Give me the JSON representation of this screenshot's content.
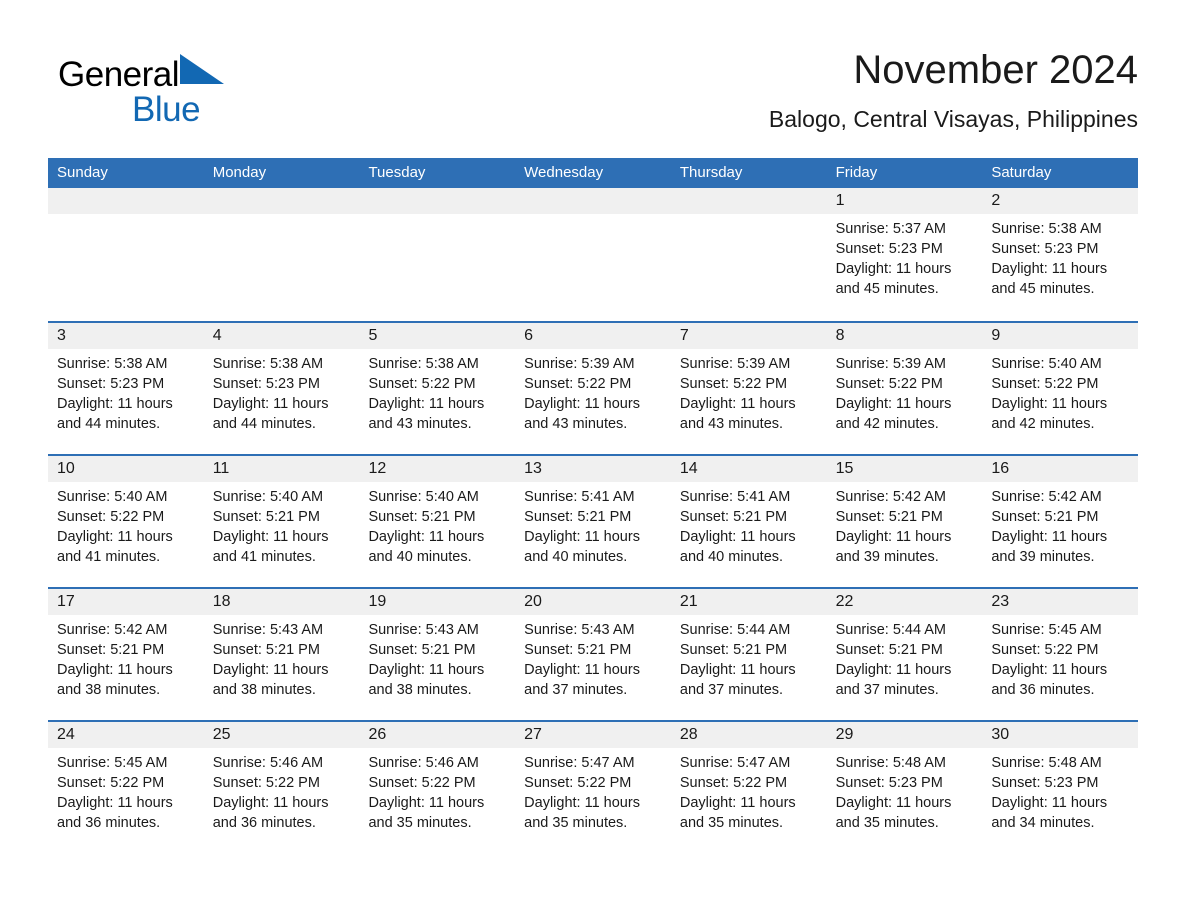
{
  "brand": {
    "name_part1": "General",
    "name_part2": "Blue",
    "triangle_color": "#1268b3"
  },
  "header": {
    "title": "November 2024",
    "subtitle": "Balogo, Central Visayas, Philippines"
  },
  "theme": {
    "accent_blue": "#2e6fb5",
    "header_text": "#ffffff",
    "day_band_gray": "#f0f0f0",
    "text": "#1a1a1a"
  },
  "weekdays": [
    "Sunday",
    "Monday",
    "Tuesday",
    "Wednesday",
    "Thursday",
    "Friday",
    "Saturday"
  ],
  "labels": {
    "sunrise_prefix": "Sunrise:",
    "sunset_prefix": "Sunset:",
    "daylight_prefix": "Daylight:"
  },
  "weeks": [
    [
      {
        "day": "",
        "empty": true
      },
      {
        "day": "",
        "empty": true
      },
      {
        "day": "",
        "empty": true
      },
      {
        "day": "",
        "empty": true
      },
      {
        "day": "",
        "empty": true
      },
      {
        "day": "1",
        "sunrise": "Sunrise: 5:37 AM",
        "sunset": "Sunset: 5:23 PM",
        "daylight": "Daylight: 11 hours and 45 minutes."
      },
      {
        "day": "2",
        "sunrise": "Sunrise: 5:38 AM",
        "sunset": "Sunset: 5:23 PM",
        "daylight": "Daylight: 11 hours and 45 minutes."
      }
    ],
    [
      {
        "day": "3",
        "sunrise": "Sunrise: 5:38 AM",
        "sunset": "Sunset: 5:23 PM",
        "daylight": "Daylight: 11 hours and 44 minutes."
      },
      {
        "day": "4",
        "sunrise": "Sunrise: 5:38 AM",
        "sunset": "Sunset: 5:23 PM",
        "daylight": "Daylight: 11 hours and 44 minutes."
      },
      {
        "day": "5",
        "sunrise": "Sunrise: 5:38 AM",
        "sunset": "Sunset: 5:22 PM",
        "daylight": "Daylight: 11 hours and 43 minutes."
      },
      {
        "day": "6",
        "sunrise": "Sunrise: 5:39 AM",
        "sunset": "Sunset: 5:22 PM",
        "daylight": "Daylight: 11 hours and 43 minutes."
      },
      {
        "day": "7",
        "sunrise": "Sunrise: 5:39 AM",
        "sunset": "Sunset: 5:22 PM",
        "daylight": "Daylight: 11 hours and 43 minutes."
      },
      {
        "day": "8",
        "sunrise": "Sunrise: 5:39 AM",
        "sunset": "Sunset: 5:22 PM",
        "daylight": "Daylight: 11 hours and 42 minutes."
      },
      {
        "day": "9",
        "sunrise": "Sunrise: 5:40 AM",
        "sunset": "Sunset: 5:22 PM",
        "daylight": "Daylight: 11 hours and 42 minutes."
      }
    ],
    [
      {
        "day": "10",
        "sunrise": "Sunrise: 5:40 AM",
        "sunset": "Sunset: 5:22 PM",
        "daylight": "Daylight: 11 hours and 41 minutes."
      },
      {
        "day": "11",
        "sunrise": "Sunrise: 5:40 AM",
        "sunset": "Sunset: 5:21 PM",
        "daylight": "Daylight: 11 hours and 41 minutes."
      },
      {
        "day": "12",
        "sunrise": "Sunrise: 5:40 AM",
        "sunset": "Sunset: 5:21 PM",
        "daylight": "Daylight: 11 hours and 40 minutes."
      },
      {
        "day": "13",
        "sunrise": "Sunrise: 5:41 AM",
        "sunset": "Sunset: 5:21 PM",
        "daylight": "Daylight: 11 hours and 40 minutes."
      },
      {
        "day": "14",
        "sunrise": "Sunrise: 5:41 AM",
        "sunset": "Sunset: 5:21 PM",
        "daylight": "Daylight: 11 hours and 40 minutes."
      },
      {
        "day": "15",
        "sunrise": "Sunrise: 5:42 AM",
        "sunset": "Sunset: 5:21 PM",
        "daylight": "Daylight: 11 hours and 39 minutes."
      },
      {
        "day": "16",
        "sunrise": "Sunrise: 5:42 AM",
        "sunset": "Sunset: 5:21 PM",
        "daylight": "Daylight: 11 hours and 39 minutes."
      }
    ],
    [
      {
        "day": "17",
        "sunrise": "Sunrise: 5:42 AM",
        "sunset": "Sunset: 5:21 PM",
        "daylight": "Daylight: 11 hours and 38 minutes."
      },
      {
        "day": "18",
        "sunrise": "Sunrise: 5:43 AM",
        "sunset": "Sunset: 5:21 PM",
        "daylight": "Daylight: 11 hours and 38 minutes."
      },
      {
        "day": "19",
        "sunrise": "Sunrise: 5:43 AM",
        "sunset": "Sunset: 5:21 PM",
        "daylight": "Daylight: 11 hours and 38 minutes."
      },
      {
        "day": "20",
        "sunrise": "Sunrise: 5:43 AM",
        "sunset": "Sunset: 5:21 PM",
        "daylight": "Daylight: 11 hours and 37 minutes."
      },
      {
        "day": "21",
        "sunrise": "Sunrise: 5:44 AM",
        "sunset": "Sunset: 5:21 PM",
        "daylight": "Daylight: 11 hours and 37 minutes."
      },
      {
        "day": "22",
        "sunrise": "Sunrise: 5:44 AM",
        "sunset": "Sunset: 5:21 PM",
        "daylight": "Daylight: 11 hours and 37 minutes."
      },
      {
        "day": "23",
        "sunrise": "Sunrise: 5:45 AM",
        "sunset": "Sunset: 5:22 PM",
        "daylight": "Daylight: 11 hours and 36 minutes."
      }
    ],
    [
      {
        "day": "24",
        "sunrise": "Sunrise: 5:45 AM",
        "sunset": "Sunset: 5:22 PM",
        "daylight": "Daylight: 11 hours and 36 minutes."
      },
      {
        "day": "25",
        "sunrise": "Sunrise: 5:46 AM",
        "sunset": "Sunset: 5:22 PM",
        "daylight": "Daylight: 11 hours and 36 minutes."
      },
      {
        "day": "26",
        "sunrise": "Sunrise: 5:46 AM",
        "sunset": "Sunset: 5:22 PM",
        "daylight": "Daylight: 11 hours and 35 minutes."
      },
      {
        "day": "27",
        "sunrise": "Sunrise: 5:47 AM",
        "sunset": "Sunset: 5:22 PM",
        "daylight": "Daylight: 11 hours and 35 minutes."
      },
      {
        "day": "28",
        "sunrise": "Sunrise: 5:47 AM",
        "sunset": "Sunset: 5:22 PM",
        "daylight": "Daylight: 11 hours and 35 minutes."
      },
      {
        "day": "29",
        "sunrise": "Sunrise: 5:48 AM",
        "sunset": "Sunset: 5:23 PM",
        "daylight": "Daylight: 11 hours and 35 minutes."
      },
      {
        "day": "30",
        "sunrise": "Sunrise: 5:48 AM",
        "sunset": "Sunset: 5:23 PM",
        "daylight": "Daylight: 11 hours and 34 minutes."
      }
    ]
  ]
}
